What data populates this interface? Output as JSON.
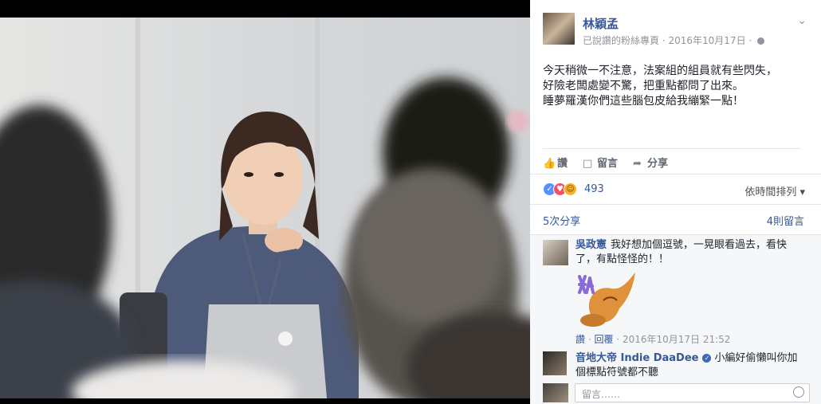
{
  "author": {
    "name": "林穎孟",
    "meta": "已說讚的粉絲專頁",
    "date": "2016年10月17日"
  },
  "post": {
    "lines": [
      "今天稍微一不注意，法案組的組員就有些閃失，",
      "好險老闆處變不驚，把重點都問了出來。",
      "睡夢羅漢你們這些腦包皮給我繃緊一點！"
    ]
  },
  "actions": {
    "like": "讚",
    "comment": "留言",
    "share": "分享"
  },
  "reactions": {
    "count": "493",
    "sort": "依時間排列"
  },
  "stats": {
    "shares": "5次分享",
    "comments": "4則留言"
  },
  "comment_list": [
    {
      "name": "吳政憲",
      "line1": "我好想加個逗號，一晃眼看過去，看快",
      "line2": "了，有點怪怪的！！",
      "like": "讚",
      "reply": "回覆",
      "timestamp": "2016年10月17日 21:52"
    },
    {
      "name": "音地大帝 Indie DaaDee",
      "line1": "小編好偷懶叫你加",
      "line2": "個標點符號都不聽"
    }
  ],
  "comment_input": {
    "placeholder": "留言……"
  },
  "colors": {
    "link": "#365899",
    "text": "#1d2129",
    "meta": "#90949c"
  },
  "icons": [
    "thumbs-up-icon",
    "comment-icon",
    "share-arrow-icon",
    "globe-icon",
    "chevron-down-icon",
    "verified-badge-icon",
    "smiley-icon"
  ]
}
